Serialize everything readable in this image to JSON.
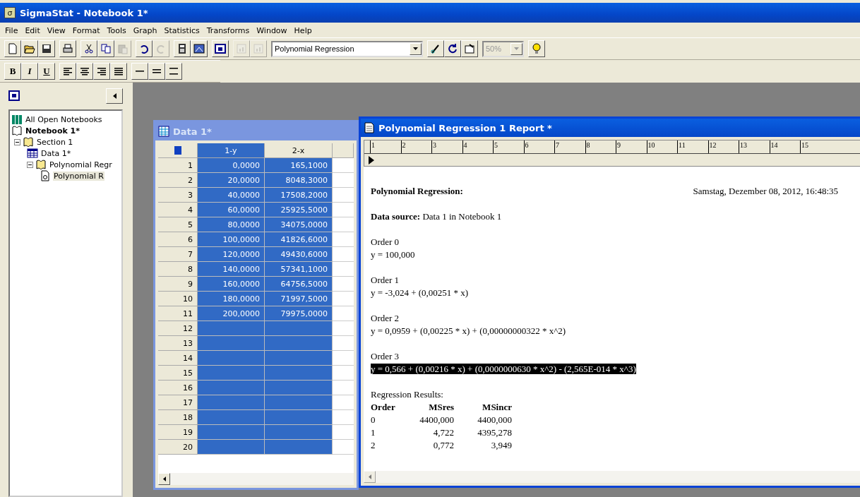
{
  "window": {
    "title": "SigmaStat - Notebook 1*",
    "icon_glyph": "σ"
  },
  "menu": [
    "File",
    "Edit",
    "View",
    "Format",
    "Tools",
    "Graph",
    "Statistics",
    "Transforms",
    "Window",
    "Help"
  ],
  "toolbar": {
    "groups": [
      [
        {
          "disabled": false
        },
        {
          "disabled": false
        },
        {
          "disabled": false
        }
      ],
      [
        {
          "disabled": false
        }
      ],
      [
        {
          "disabled": false
        },
        {
          "disabled": false
        },
        {
          "disabled": true
        }
      ],
      [
        {
          "disabled": false
        },
        {
          "disabled": true
        }
      ],
      [
        {
          "disabled": false
        },
        {
          "disabled": false
        }
      ],
      [
        {
          "disabled": false
        }
      ],
      [
        {
          "disabled": true
        },
        {
          "disabled": true
        }
      ],
      [
        {
          "disabled": false
        },
        {
          "disabled": false
        },
        {
          "disabled": false
        }
      ],
      [
        {
          "disabled": false
        }
      ]
    ],
    "analysis_select": {
      "value": "Polynomial Regression"
    },
    "zoom_select": {
      "value": "50%",
      "disabled": true
    }
  },
  "format_toolbar": {
    "style_buttons": [
      "B",
      "I",
      "U"
    ]
  },
  "tree": [
    {
      "label": "All Open Notebooks",
      "kind": "notebooks",
      "selected": false
    },
    {
      "label": "Notebook 1*",
      "kind": "notebook",
      "selected": false,
      "children": [
        {
          "label": "Section 1",
          "kind": "section",
          "expanded": true,
          "selected": false,
          "children": [
            {
              "label": "Data 1*",
              "kind": "worksheet",
              "selected": false
            },
            {
              "label": "Polynomial Regr",
              "kind": "section",
              "expanded": true,
              "selected": false,
              "children": [
                {
                  "label": "Polynomial R",
                  "kind": "report",
                  "selected": true
                }
              ]
            }
          ]
        }
      ]
    }
  ],
  "worksheet": {
    "title": "Data 1*",
    "columns": [
      {
        "label": "1-y",
        "selected": true
      },
      {
        "label": "2-x",
        "selected": false
      }
    ],
    "rows": [
      {
        "number": "1",
        "cells": [
          "0,0000",
          "165,1000"
        ],
        "selected": true
      },
      {
        "number": "2",
        "cells": [
          "20,0000",
          "8048,3000"
        ],
        "selected": true
      },
      {
        "number": "3",
        "cells": [
          "40,0000",
          "17508,2000"
        ],
        "selected": true
      },
      {
        "number": "4",
        "cells": [
          "60,0000",
          "25925,5000"
        ],
        "selected": true
      },
      {
        "number": "5",
        "cells": [
          "80,0000",
          "34075,0000"
        ],
        "selected": true
      },
      {
        "number": "6",
        "cells": [
          "100,0000",
          "41826,6000"
        ],
        "selected": true
      },
      {
        "number": "7",
        "cells": [
          "120,0000",
          "49430,6000"
        ],
        "selected": true
      },
      {
        "number": "8",
        "cells": [
          "140,0000",
          "57341,1000"
        ],
        "selected": true
      },
      {
        "number": "9",
        "cells": [
          "160,0000",
          "64756,5000"
        ],
        "selected": true
      },
      {
        "number": "10",
        "cells": [
          "180,0000",
          "71997,5000"
        ],
        "selected": true
      },
      {
        "number": "11",
        "cells": [
          "200,0000",
          "79975,0000"
        ],
        "selected": true
      },
      {
        "number": "12",
        "cells": [
          "",
          ""
        ],
        "selected": true
      },
      {
        "number": "13",
        "cells": [
          "",
          ""
        ],
        "selected": true
      },
      {
        "number": "14",
        "cells": [
          "",
          ""
        ],
        "selected": true
      },
      {
        "number": "15",
        "cells": [
          "",
          ""
        ],
        "selected": true
      },
      {
        "number": "16",
        "cells": [
          "",
          ""
        ],
        "selected": true
      },
      {
        "number": "17",
        "cells": [
          "",
          ""
        ],
        "selected": true
      },
      {
        "number": "18",
        "cells": [
          "",
          ""
        ],
        "selected": true
      },
      {
        "number": "19",
        "cells": [
          "",
          ""
        ],
        "selected": true
      },
      {
        "number": "20",
        "cells": [
          "",
          ""
        ],
        "selected": true
      }
    ]
  },
  "report": {
    "title": "Polynomial Regression 1 Report *",
    "ruler": [
      "1",
      "2",
      "3",
      "4",
      "5",
      "6",
      "7",
      "8",
      "9",
      "10",
      "11",
      "12",
      "13",
      "14",
      "15"
    ],
    "heading": "Polynomial Regression:",
    "date": "Samstag, Dezember 08, 2012, 16:48:35",
    "source": "**Data source:** Data 1 in Notebook 1",
    "orders": [
      {
        "label": "Order  0",
        "equation": "y = 100,000",
        "highlighted": false
      },
      {
        "label": "Order  1",
        "equation": "y = -3,024 + (0,00251  * x)",
        "highlighted": false
      },
      {
        "label": "Order  2",
        "equation": "y = 0,0959 + (0,00225 * x) + (0,00000000322 * x^2)",
        "highlighted": false
      },
      {
        "label": "Order  3",
        "equation": "y = 0,566 + (0,00216 * x) + (0,0000000630 * x^2) - (2,565E-014 * x^3)",
        "highlighted": true
      }
    ],
    "results_title": "Regression Results:",
    "results_columns": [
      "Order",
      "MSres",
      "MSincr"
    ],
    "results_rows": [
      [
        "0",
        "4400,000",
        "4400,000"
      ],
      [
        "1",
        "4,722",
        "4395,278"
      ],
      [
        "2",
        "0,772",
        "3,949"
      ]
    ]
  }
}
